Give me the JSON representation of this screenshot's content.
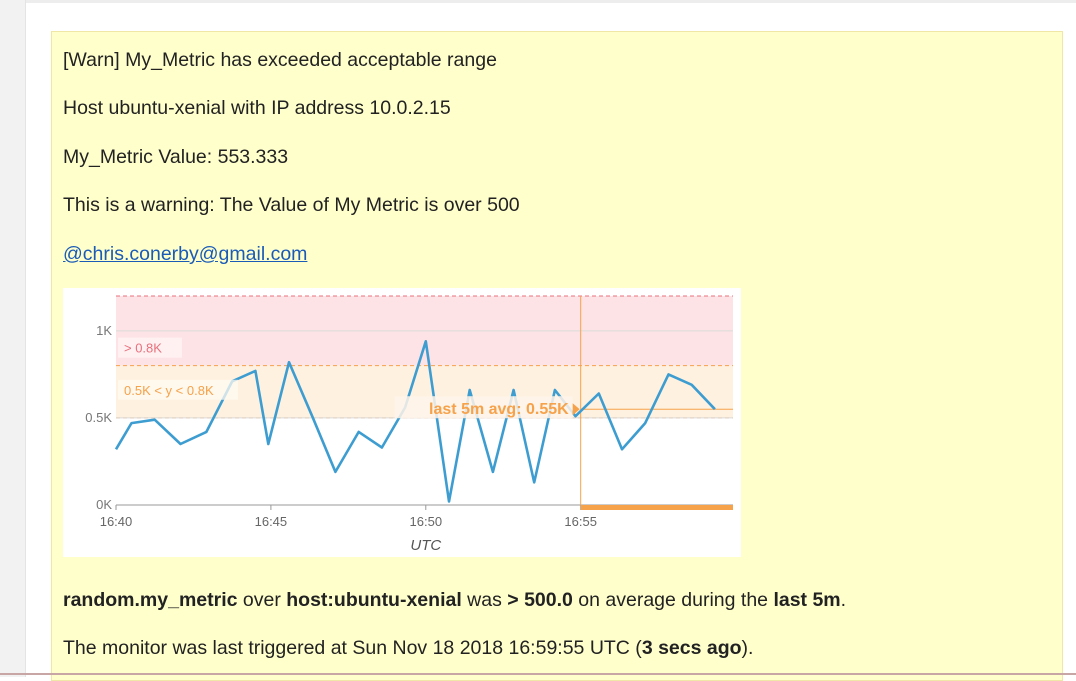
{
  "alert": {
    "title": "[Warn] My_Metric has exceeded acceptable range",
    "host_line": "Host ubuntu-xenial with IP address 10.0.2.15",
    "value_line": "My_Metric Value: 553.333",
    "warning_line": "This is a warning: The Value of My Metric is over 500",
    "mention": "@chris.conerby@gmail.com",
    "summary": {
      "metric": "random.my_metric",
      "t1": " over ",
      "scope": "host:ubuntu-xenial",
      "t2": " was ",
      "condition": "> 500.0",
      "t3": " on average during the ",
      "window": "last 5m",
      "t4": "."
    },
    "triggered": {
      "prefix": "The monitor was last triggered at Sun Nov 18 2018 16:59:55 UTC (",
      "ago": "3 secs ago",
      "suffix": ")."
    }
  },
  "colors": {
    "background": "#ffffcc",
    "link": "#1a5bb8",
    "critical_band": "#fde3e6",
    "warning_band": "#fff1e0",
    "series": "#3d9dd1",
    "threshold_orange": "#f6a24b",
    "critical_text": "#e8707c"
  },
  "chart_data": {
    "type": "line",
    "xlabel": "UTC",
    "x_ticks": [
      "16:40",
      "16:45",
      "16:50",
      "16:55"
    ],
    "y_ticks": [
      "0K",
      "0.5K",
      "1K"
    ],
    "ylim": [
      0,
      1200
    ],
    "xlim": [
      "16:40",
      "16:59:55"
    ],
    "bands": [
      {
        "label": "> 0.8K",
        "from": 800,
        "to": 1200,
        "kind": "critical"
      },
      {
        "label": "0.5K < y < 0.8K",
        "from": 500,
        "to": 800,
        "kind": "warning"
      }
    ],
    "annotation": {
      "label": "last 5m avg: 0.55K",
      "value": 550
    },
    "marker_time": "16:55",
    "series": [
      {
        "x": [
          "16:40:00",
          "16:40:30",
          "16:41:15",
          "16:42:05",
          "16:42:55",
          "16:43:45",
          "16:44:30",
          "16:44:55",
          "16:45:35",
          "16:46:20",
          "16:47:05",
          "16:47:50",
          "16:48:35",
          "16:49:20",
          "16:50:00",
          "16:50:45",
          "16:51:25",
          "16:52:10",
          "16:52:50",
          "16:53:30",
          "16:54:10",
          "16:54:50",
          "16:55:35",
          "16:56:20",
          "16:57:05",
          "16:57:50",
          "16:58:35",
          "16:59:20"
        ],
        "y": [
          320,
          470,
          490,
          350,
          420,
          710,
          770,
          350,
          820,
          510,
          190,
          420,
          330,
          560,
          940,
          20,
          660,
          190,
          660,
          130,
          660,
          510,
          640,
          320,
          470,
          750,
          690,
          550
        ]
      }
    ]
  }
}
